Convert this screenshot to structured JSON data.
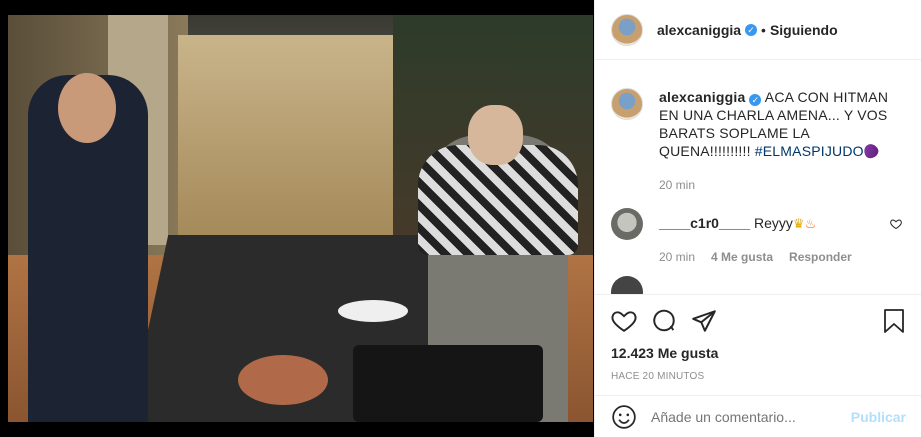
{
  "post": {
    "image_alt": "Foto de cocina de MasterChef"
  },
  "header": {
    "username": "alexcaniggia",
    "verified_badge": "verified-icon",
    "separator": "•",
    "follow_state": "Siguiendo"
  },
  "caption": {
    "username": "alexcaniggia",
    "text": "ACA CON HITMAN EN UNA CHARLA AMENA... Y VOS BARATS SOPLAME LA QUENA!!!!!!!!!!",
    "hashtag": "#ELMASPIJUDO",
    "emoji": "eggplant-icon",
    "time": "20 min"
  },
  "comments": [
    {
      "username": "____c1r0____",
      "text": "Reyyy",
      "emojis": [
        "crown-icon",
        "fire-icon"
      ],
      "time": "20 min",
      "likes": "4 Me gusta",
      "reply_label": "Responder"
    }
  ],
  "actions": {
    "likes_count": "12.423 Me gusta",
    "posted_ago": "HACE 20 MINUTOS"
  },
  "composer": {
    "placeholder": "Añade un comentario...",
    "publish_label": "Publicar"
  },
  "colors": {
    "verified": "#3897f0",
    "hashtag": "#00376b",
    "publish_disabled": "#b2dffc",
    "muted": "#8e8e8e"
  }
}
